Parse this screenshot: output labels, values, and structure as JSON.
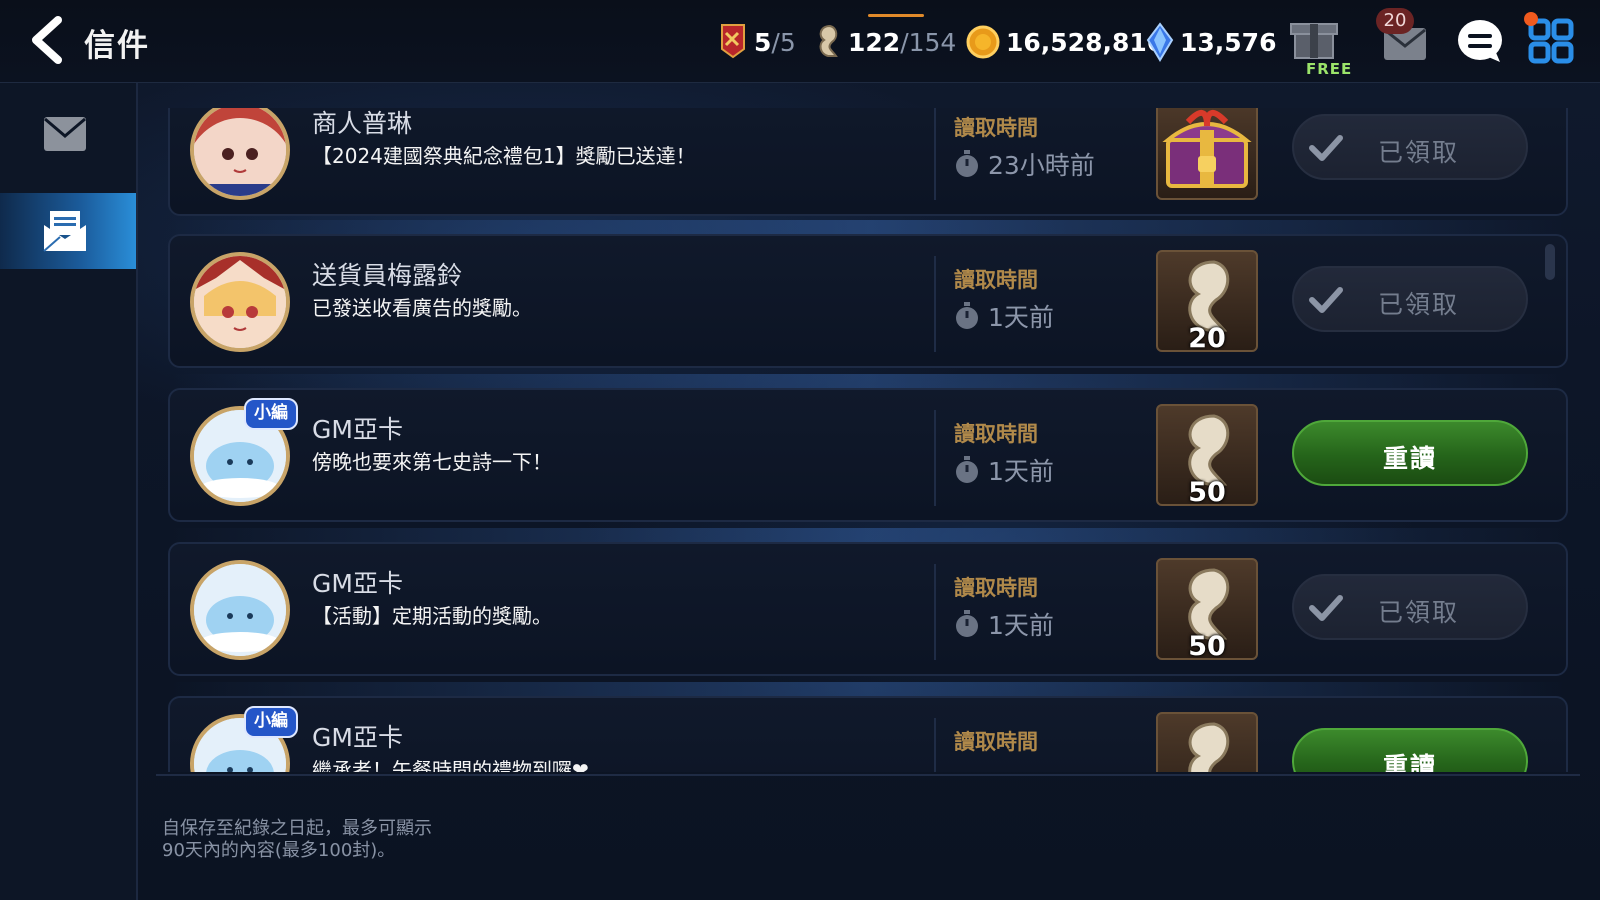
{
  "header": {
    "title": "信件",
    "resources": {
      "battle_tickets": {
        "value": "5",
        "max": "/5"
      },
      "stamina": {
        "value": "122",
        "max": "/154"
      },
      "gold": {
        "value": "16,528,816"
      },
      "crystal": {
        "value": "13,576"
      }
    },
    "free_label": "FREE",
    "mail_badge": "20"
  },
  "sidebar": {
    "tabs": [
      {
        "name": "mail-inbox",
        "icon": "envelope-icon",
        "active": false
      },
      {
        "name": "mail-read",
        "icon": "open-envelope-icon",
        "active": true
      }
    ]
  },
  "mails": [
    {
      "sender": "商人普琳",
      "message": "【2024建國祭典紀念禮包1】獎勵已送達！",
      "read_time_label": "讀取時間",
      "read_time": "23小時前",
      "reward": "treasure-chest",
      "reward_qty": "",
      "button": "已領取",
      "state": "claimed",
      "tag": ""
    },
    {
      "sender": "送貨員梅露鈴",
      "message": "已發送收看廣告的獎勵。",
      "read_time_label": "讀取時間",
      "read_time": "1天前",
      "reward": "stamina-horse",
      "reward_qty": "20",
      "button": "已領取",
      "state": "claimed",
      "tag": ""
    },
    {
      "sender": "GM亞卡",
      "message": "傍晚也要來第七史詩一下！",
      "read_time_label": "讀取時間",
      "read_time": "1天前",
      "reward": "stamina-horse",
      "reward_qty": "50",
      "button": "重讀",
      "state": "reread",
      "tag": "小編"
    },
    {
      "sender": "GM亞卡",
      "message": "【活動】定期活動的獎勵。",
      "read_time_label": "讀取時間",
      "read_time": "1天前",
      "reward": "stamina-horse",
      "reward_qty": "50",
      "button": "已領取",
      "state": "claimed",
      "tag": ""
    },
    {
      "sender": "GM亞卡",
      "message": "繼承者！午餐時間的禮物到囉❤",
      "read_time_label": "讀取時間",
      "read_time": "",
      "reward": "stamina-horse",
      "reward_qty": "",
      "button": "重讀",
      "state": "reread",
      "tag": "小編"
    }
  ],
  "footnote": {
    "line1": "自保存至紀錄之日起，最多可顯示",
    "line2": "90天內的內容(最多100封)。"
  },
  "colors": {
    "accent_blue": "#2a8ed8",
    "reread_green": "#3c8a2c",
    "label_gold": "#b0894a"
  }
}
